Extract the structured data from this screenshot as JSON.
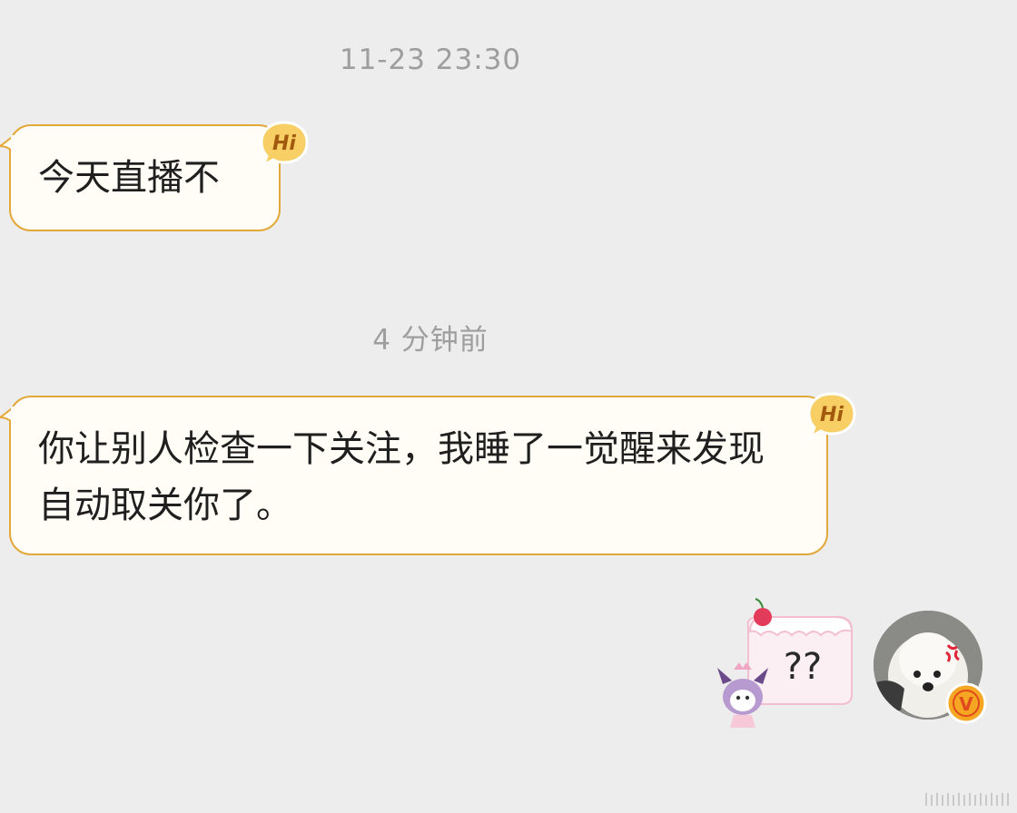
{
  "chat": {
    "timestamps": [
      "11-23 23:30",
      "4 分钟前"
    ],
    "messages": [
      {
        "sender": "other",
        "text": "今天直播不",
        "badge": "Hi"
      },
      {
        "sender": "other",
        "text": "你让别人检查一下关注，我睡了一觉醒来发现自动取关你了。",
        "badge": "Hi"
      }
    ],
    "sent_sticker": {
      "icon": "question-cake-sticker-icon",
      "text": "??"
    },
    "self_avatar": {
      "icon": "white-dog-avatar",
      "verified_badge": "V"
    }
  },
  "colors": {
    "background": "#ededed",
    "bubble_fill": "#fffdf5",
    "bubble_border": "#e2a93a",
    "hi_badge": "#f7cf64",
    "verified_badge": "#f5a623",
    "timestamp_text": "#9e9e9e"
  }
}
